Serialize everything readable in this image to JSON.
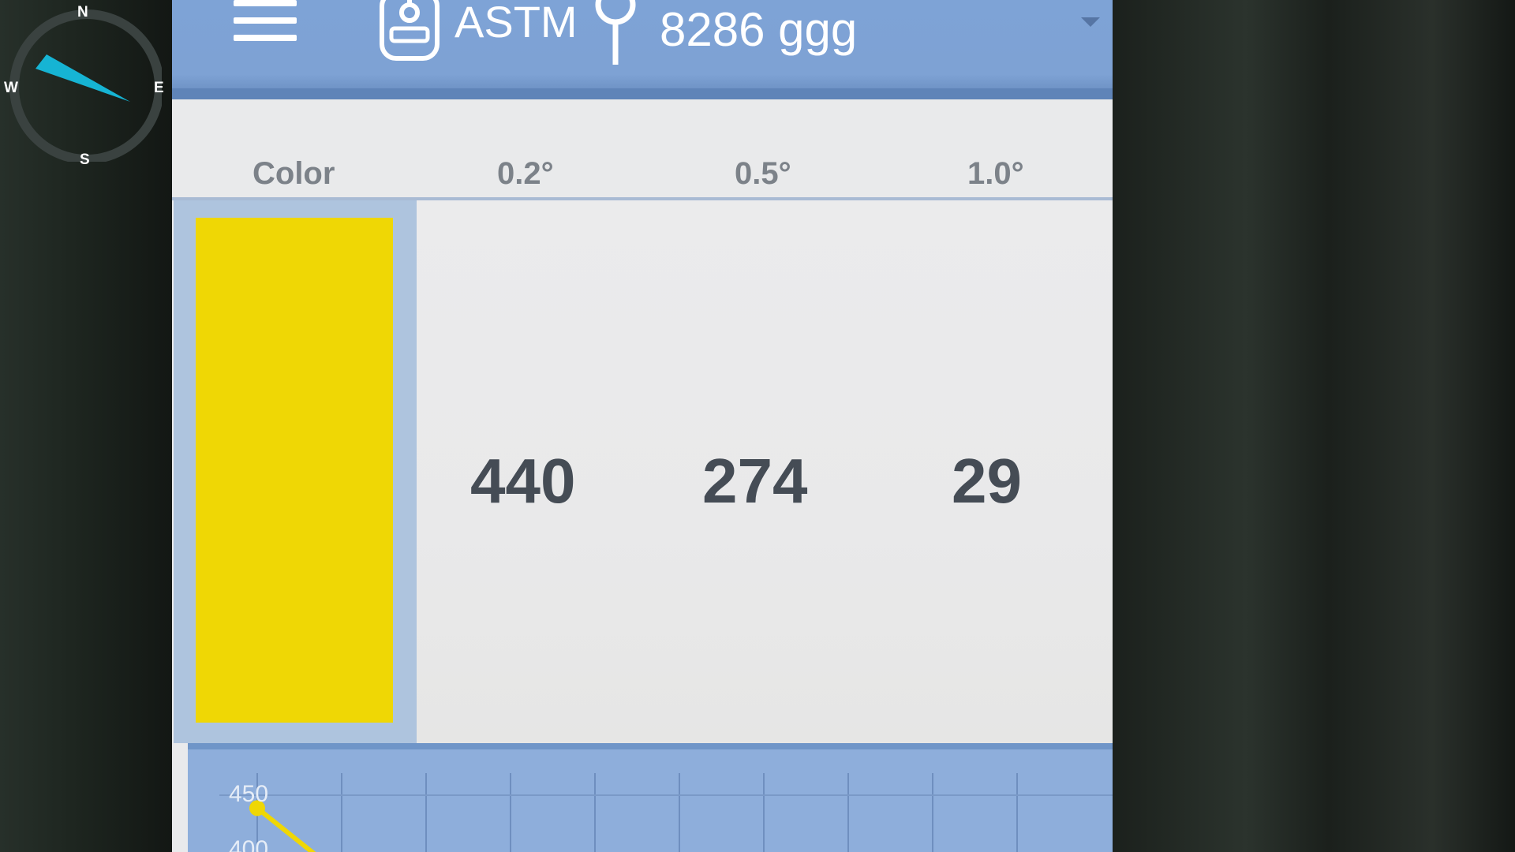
{
  "compass": {
    "n": "N",
    "s": "S",
    "w": "W",
    "e": "E",
    "needle_color": "#16b4d4"
  },
  "topbar": {
    "app_title": "ASTM",
    "sample_id": "8286 ggg",
    "menu_icon": "hamburger-menu-icon",
    "device_icon": "device-icon",
    "pin_icon": "pin-icon"
  },
  "table": {
    "headers": [
      "Color",
      "0.2°",
      "0.5°",
      "1.0°"
    ],
    "values": [
      "440",
      "274",
      "29"
    ],
    "swatch_color": "#efd705"
  },
  "chart_data": {
    "type": "line",
    "ytick_labels": [
      "450",
      "400"
    ],
    "series": [
      {
        "values": [
          440
        ],
        "color": "#efd705"
      }
    ]
  }
}
